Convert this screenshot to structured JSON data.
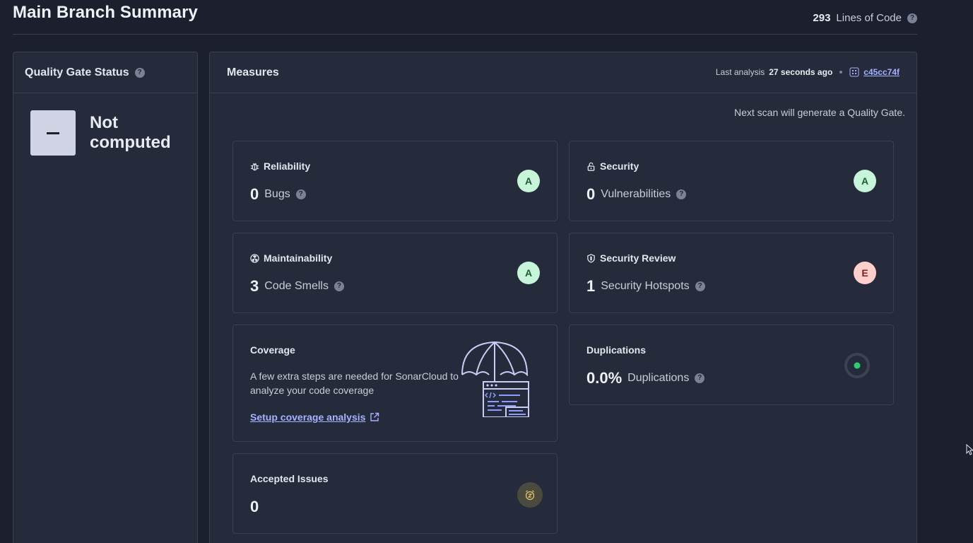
{
  "header": {
    "title": "Main Branch Summary",
    "loc_value": "293",
    "loc_label": "Lines of Code"
  },
  "quality_gate": {
    "title": "Quality Gate Status",
    "status_text": "Not computed"
  },
  "measures": {
    "title": "Measures",
    "last_analysis_label": "Last analysis",
    "last_analysis_value": "27 seconds ago",
    "commit": "c45cc74f",
    "next_scan": "Next scan will generate a Quality Gate.",
    "reliability": {
      "title": "Reliability",
      "value": "0",
      "label": "Bugs",
      "grade": "A"
    },
    "security": {
      "title": "Security",
      "value": "0",
      "label": "Vulnerabilities",
      "grade": "A"
    },
    "maintainability": {
      "title": "Maintainability",
      "value": "3",
      "label": "Code Smells",
      "grade": "A"
    },
    "security_review": {
      "title": "Security Review",
      "value": "1",
      "label": "Security Hotspots",
      "grade": "E"
    },
    "coverage": {
      "title": "Coverage",
      "description": "A few extra steps are needed for SonarCloud to analyze your code coverage",
      "link": "Setup coverage analysis"
    },
    "duplications": {
      "title": "Duplications",
      "value": "0.0%",
      "label": "Duplications"
    },
    "accepted_issues": {
      "title": "Accepted Issues",
      "value": "0"
    }
  },
  "colors": {
    "background": "#1b1f2e",
    "panel": "#262b3b",
    "grade_a": "#c7f5d9",
    "grade_e": "#ffd0cc",
    "link": "#a6b2ff"
  }
}
